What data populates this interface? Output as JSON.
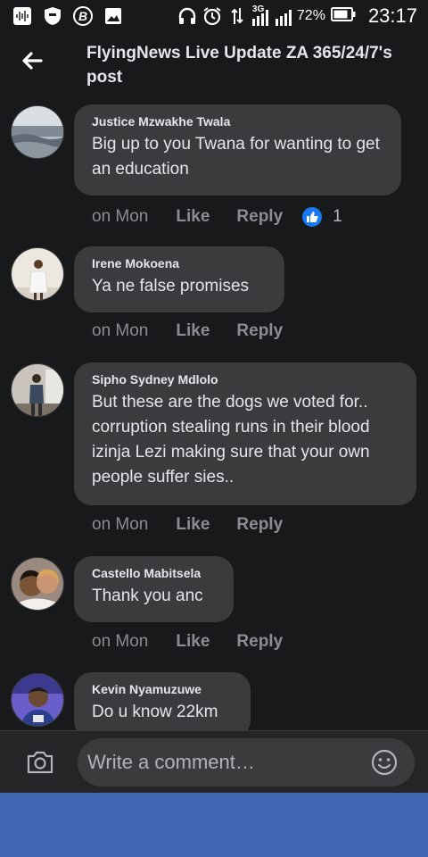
{
  "status_bar": {
    "signal_label": "3G",
    "battery_percent": "72%",
    "time": "23:17",
    "icons": [
      "sound-wave-icon",
      "shield-icon",
      "b-badge-icon",
      "image-icon",
      "headphones-icon",
      "alarm-icon",
      "data-transfer-icon",
      "signal-icon",
      "battery-icon"
    ]
  },
  "header": {
    "title": "FlyingNews Live Update ZA 365/24/7's post",
    "back_icon": "back-arrow-icon"
  },
  "colors": {
    "background": "#18191a",
    "bubble": "#3a3b3c",
    "composer": "#242526",
    "muted_text": "#8a8d91",
    "like_blue": "#1877f2",
    "nav_blue": "#4267b2"
  },
  "comments": [
    {
      "author": "Justice Mzwakhe Twala",
      "text": "Big up to you Twana for wanting to get an education",
      "time": "on Mon",
      "like_label": "Like",
      "reply_label": "Reply",
      "reaction_count": "1"
    },
    {
      "author": "Irene Mokoena",
      "text": "Ya ne false promises",
      "time": "on Mon",
      "like_label": "Like",
      "reply_label": "Reply"
    },
    {
      "author": "Sipho Sydney Mdlolo",
      "text": "But these are the dogs we voted for.. corruption stealing runs in their blood izinja Lezi making sure that your own people suffer sies..",
      "time": "on Mon",
      "like_label": "Like",
      "reply_label": "Reply"
    },
    {
      "author": "Castello Mabitsela",
      "text": "Thank you anc",
      "time": "on Mon",
      "like_label": "Like",
      "reply_label": "Reply"
    },
    {
      "author": "Kevin Nyamuzuwe",
      "text": "Do u know 22km"
    }
  ],
  "composer": {
    "placeholder": "Write a comment…",
    "camera_icon": "camera-icon",
    "emoji_icon": "emoji-icon"
  }
}
